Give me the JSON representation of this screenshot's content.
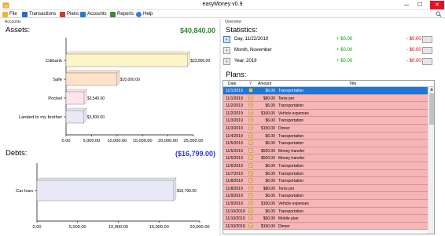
{
  "window": {
    "title": "easyMoney v0.9",
    "minimize": "—",
    "maximize": "☐",
    "close": "✕"
  },
  "menu": [
    {
      "label": "File",
      "icon": "file-icon",
      "color": "#f0b428"
    },
    {
      "label": "Transactions",
      "icon": "transactions-icon",
      "color": "#2a6ac8"
    },
    {
      "label": "Plans",
      "icon": "calendar-icon",
      "color": "#d03a2a"
    },
    {
      "label": "Accounts",
      "icon": "accounts-icon",
      "color": "#2a7ac8"
    },
    {
      "label": "Reports",
      "icon": "reports-icon",
      "color": "#3a8a3a"
    },
    {
      "label": "Help",
      "icon": "help-icon",
      "color": "#3a7ad8"
    }
  ],
  "accounts_panel": {
    "label": "Accounts",
    "assets": {
      "title": "Assets:",
      "total": "$40,840.00",
      "total_color": "#2a8a2a"
    },
    "debts": {
      "title": "Debts:",
      "total": "($16,799.00)",
      "total_color": "#2a3ad8"
    }
  },
  "chart_data": [
    {
      "type": "bar",
      "orientation": "horizontal",
      "categories": [
        "Citibank",
        "Safe",
        "Pocket",
        "Landed to my brother"
      ],
      "values": [
        23800,
        10000,
        3540,
        3500
      ],
      "value_labels": [
        "$23,800.00",
        "$10,000.00",
        "$3,540.00",
        "$3,500.00"
      ],
      "colors": [
        "#fdf5c8",
        "#fde2c8",
        "#fde4ee",
        "#e8e8f7"
      ],
      "xlim": [
        0,
        25000
      ],
      "xticks": [
        "0.00",
        "5,000.00",
        "10,000.00",
        "15,000.00",
        "20,000.00",
        "25,000.00"
      ],
      "grid": false
    },
    {
      "type": "bar",
      "orientation": "horizontal",
      "categories": [
        "Car loan"
      ],
      "values": [
        16799
      ],
      "value_labels": [
        "$16,799.00"
      ],
      "colors": [
        "#e8e8f7"
      ],
      "xlim": [
        0,
        20000
      ],
      "xticks": [
        "0.00",
        "5,000.00",
        "10,000.00",
        "15,000.00",
        "20,000.00"
      ],
      "grid": false
    }
  ],
  "overview": {
    "label": "Overview",
    "statistics_title": "Statistics:",
    "stats": [
      {
        "button": "‹",
        "label": "Day, 11/22/2019",
        "plus": "+ $0.00",
        "minus": "- $0.00",
        "selected": true
      },
      {
        "button": "‹",
        "label": "Month, November",
        "plus": "+ $0.00",
        "minus": "- $0.00",
        "selected": false
      },
      {
        "button": "‹",
        "label": "Year, 2019",
        "plus": "+ $0.00",
        "minus": "- $0.00",
        "selected": false
      }
    ],
    "plans_title": "Plans:",
    "columns": [
      "Date",
      "?",
      "Amount",
      "Title"
    ],
    "plans": [
      {
        "date": "11/1/2019",
        "amount": "$6.00",
        "title": "Transportation"
      },
      {
        "date": "11/1/2019",
        "amount": "$80.00",
        "title": "Tenis pro"
      },
      {
        "date": "11/2/2019",
        "amount": "$6.00",
        "title": "Transportation"
      },
      {
        "date": "11/2/2019",
        "amount": "$100.00",
        "title": "Vehicle expenses"
      },
      {
        "date": "11/3/2019",
        "amount": "$6.00",
        "title": "Transportation"
      },
      {
        "date": "11/3/2019",
        "amount": "$150.00",
        "title": "Dinner"
      },
      {
        "date": "11/4/2019",
        "amount": "$6.00",
        "title": "Transportation"
      },
      {
        "date": "11/5/2019",
        "amount": "$6.00",
        "title": "Transportation"
      },
      {
        "date": "11/5/2019",
        "amount": "$500.00",
        "title": "Money transfer"
      },
      {
        "date": "11/5/2019",
        "amount": "$500.00",
        "title": "Money transfer"
      },
      {
        "date": "11/6/2019",
        "amount": "$6.00",
        "title": "Transportation"
      },
      {
        "date": "11/7/2019",
        "amount": "$6.00",
        "title": "Transportation"
      },
      {
        "date": "11/8/2019",
        "amount": "$6.00",
        "title": "Transportation"
      },
      {
        "date": "11/8/2019",
        "amount": "$80.00",
        "title": "Tenis pro"
      },
      {
        "date": "11/9/2019",
        "amount": "$6.00",
        "title": "Transportation"
      },
      {
        "date": "11/9/2019",
        "amount": "$100.00",
        "title": "Vehicle expenses"
      },
      {
        "date": "11/10/2019",
        "amount": "$6.00",
        "title": "Transportation"
      },
      {
        "date": "11/10/2019",
        "amount": "$50.00",
        "title": "Mobile plan"
      },
      {
        "date": "11/10/2019",
        "amount": "$150.00",
        "title": "Dinner"
      }
    ],
    "selected_row": 0,
    "row_color": "#f4b6b6",
    "selected_color": "#1e78d7"
  }
}
